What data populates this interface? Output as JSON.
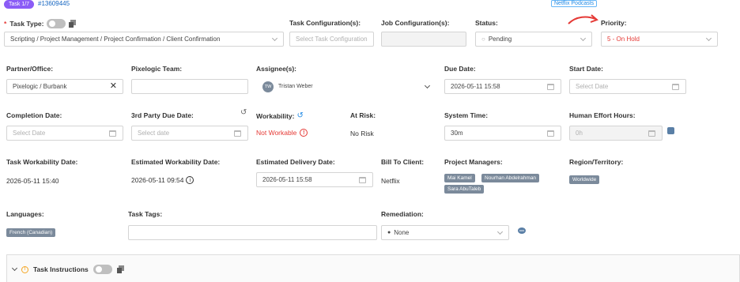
{
  "header": {
    "task_badge": "Task 1/7",
    "task_id": "#13609445",
    "netflix_tag": "Netflix Podcasts"
  },
  "row1": {
    "task_type_label": "Task Type:",
    "task_type_value": "Scripting / Project Management / Project Confirmation / Client Confirmation",
    "task_config_label": "Task Configuration(s):",
    "task_config_placeholder": "Select Task Configuration",
    "job_config_label": "Job Configuration(s):",
    "status_label": "Status:",
    "status_value": "Pending",
    "priority_label": "Priority:",
    "priority_value": "5 - On Hold"
  },
  "row2": {
    "partner_label": "Partner/Office:",
    "partner_value": "Pixelogic / Burbank",
    "team_label": "Pixelogic Team:",
    "assignee_label": "Assignee(s):",
    "assignee_initials": "TW",
    "assignee_name": "Tristan Weber",
    "due_label": "Due Date:",
    "due_value": "2026-05-11 15:58",
    "start_label": "Start Date:",
    "start_placeholder": "Select Date"
  },
  "row3": {
    "completion_label": "Completion Date:",
    "completion_placeholder": "Select Date",
    "third_party_label": "3rd Party Due Date:",
    "third_party_placeholder": "Select date",
    "workability_label": "Workability:",
    "workability_value": "Not Workable",
    "at_risk_label": "At Risk:",
    "at_risk_value": "No Risk",
    "system_time_label": "System Time:",
    "system_time_value": "30m",
    "effort_label": "Human Effort Hours:",
    "effort_value": "0h"
  },
  "row4": {
    "task_work_date_label": "Task Workability Date:",
    "task_work_date_value": "2026-05-11 15:40",
    "est_work_date_label": "Estimated Workability Date:",
    "est_work_date_value": "2026-05-11 09:54",
    "est_delivery_label": "Estimated Delivery Date:",
    "est_delivery_value": "2026-05-11 15:58",
    "bill_label": "Bill To Client:",
    "bill_value": "Netflix",
    "pm_label": "Project Managers:",
    "pms": [
      "Mai Kamel",
      "Nourhan Abdelrahman",
      "Sara AbuTaleb"
    ],
    "region_label": "Region/Territory:",
    "region_value": "Worldwide"
  },
  "row5": {
    "languages_label": "Languages:",
    "language_value": "French (Canadian)",
    "tags_label": "Task Tags:",
    "remediation_label": "Remediation:",
    "remediation_value": "None"
  },
  "instructions": {
    "label": "Task Instructions"
  },
  "colors": {
    "accent": "#8b5cf6",
    "danger": "#e53935",
    "chip": "#7b8a9b",
    "link": "#1e88e5"
  }
}
